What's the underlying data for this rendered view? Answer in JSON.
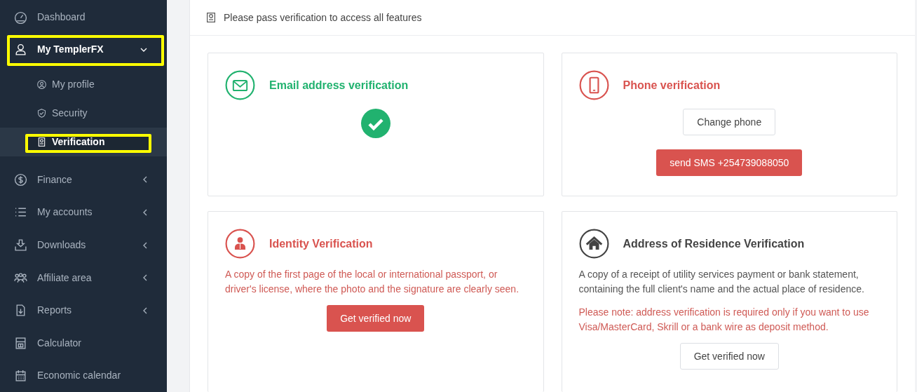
{
  "sidebar": {
    "items": [
      {
        "label": "Dashboard",
        "has_submenu": false,
        "expanded": false,
        "highlighted": false
      },
      {
        "label": "My TemplerFX",
        "has_submenu": true,
        "expanded": true,
        "highlighted": true,
        "children": [
          {
            "label": "My profile",
            "selected": false,
            "highlighted": false
          },
          {
            "label": "Security",
            "selected": false,
            "highlighted": false
          },
          {
            "label": "Verification",
            "selected": true,
            "highlighted": true
          }
        ]
      },
      {
        "label": "Finance",
        "has_submenu": true,
        "expanded": false,
        "highlighted": false
      },
      {
        "label": "My accounts",
        "has_submenu": true,
        "expanded": false,
        "highlighted": false
      },
      {
        "label": "Downloads",
        "has_submenu": true,
        "expanded": false,
        "highlighted": false
      },
      {
        "label": "Affiliate area",
        "has_submenu": true,
        "expanded": false,
        "highlighted": false
      },
      {
        "label": "Reports",
        "has_submenu": true,
        "expanded": false,
        "highlighted": false
      },
      {
        "label": "Calculator",
        "has_submenu": false,
        "expanded": false,
        "highlighted": false
      },
      {
        "label": "Economic calendar",
        "has_submenu": false,
        "expanded": false,
        "highlighted": false
      }
    ]
  },
  "notice": "Please pass verification to access all features",
  "cards": [
    {
      "verified": true,
      "title": "Email address verification"
    },
    {
      "verified": false,
      "required": true,
      "title": "Phone verification",
      "buttons": [
        {
          "label": "Change phone",
          "primary": false
        },
        {
          "label": "send SMS +254739088050",
          "primary": true
        }
      ]
    },
    {
      "verified": false,
      "required": true,
      "title": "Identity Verification",
      "paragraphs": [
        {
          "text": "A copy of the first page of the local or international passport, or driver's license, where the photo and the signature are clearly seen.",
          "warning": true
        }
      ],
      "buttons": [
        {
          "label": "Get verified now",
          "primary": true
        }
      ]
    },
    {
      "verified": false,
      "required": false,
      "title": "Address of Residence Verification",
      "paragraphs": [
        {
          "text": "A copy of a receipt of utility services payment or bank statement, containing the full client's name and the actual place of residence.",
          "warning": false
        },
        {
          "text": "Please note: address verification is required only if you want to use Visa/MasterCard, Skrill or a bank wire as deposit method.",
          "warning": true
        }
      ],
      "buttons": [
        {
          "label": "Get verified now",
          "primary": false
        }
      ]
    }
  ]
}
